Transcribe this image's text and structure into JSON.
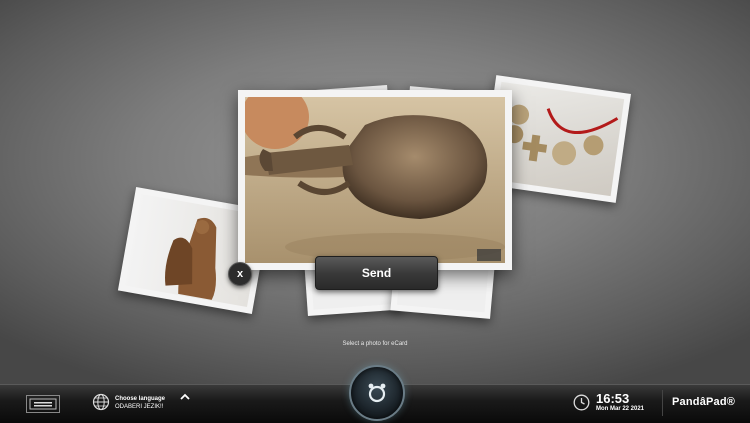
{
  "gallery": {
    "send_label": "Send",
    "close_label": "x",
    "hint": "Select a photo for eCard",
    "photos": [
      {
        "name": "amphora"
      },
      {
        "name": "coins-necklace"
      },
      {
        "name": "statue"
      }
    ]
  },
  "taskbar": {
    "language_title": "Choose language",
    "language_subtitle": "ODABERI JEZIK!!",
    "time": "16:53",
    "date": "Mon Mar 22 2021",
    "brand": "PandâPad®"
  },
  "icons": {
    "globe": "globe-icon",
    "clock": "clock-icon",
    "chevron": "chevron-up-icon",
    "home": "pandopad-home-icon"
  }
}
